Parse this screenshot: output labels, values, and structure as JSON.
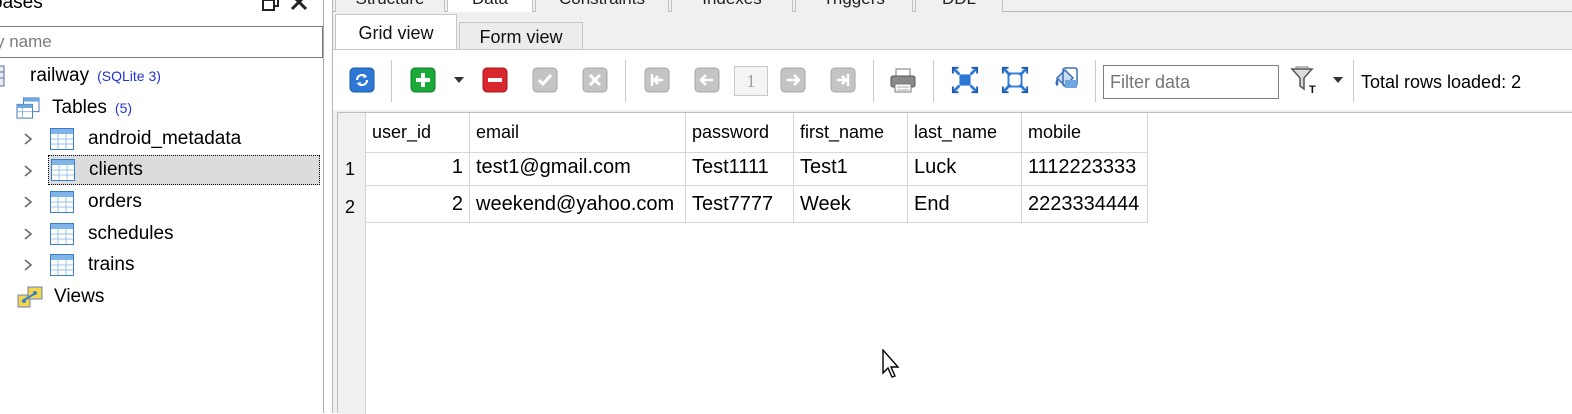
{
  "left_panel": {
    "title": "bases",
    "filter_placeholder": "y name",
    "tree": {
      "database": {
        "label": "railway",
        "note": "(SQLite 3)"
      },
      "tables": {
        "label": "Tables",
        "count": "(5)"
      },
      "table_items": [
        "android_metadata",
        "clients",
        "orders",
        "schedules",
        "trains"
      ],
      "views": {
        "label": "Views"
      }
    }
  },
  "tabs": {
    "top": [
      "Structure",
      "Data",
      "Constraints",
      "Indexes",
      "Triggers",
      "DDL"
    ],
    "sub": [
      "Grid view",
      "Form view"
    ]
  },
  "toolbar": {
    "page_number": "1",
    "filter_placeholder": "Filter data",
    "total_rows": "Total rows loaded: 2"
  },
  "grid": {
    "columns": [
      "user_id",
      "email",
      "password",
      "first_name",
      "last_name",
      "mobile"
    ],
    "rows": [
      {
        "num": "1",
        "user_id": "1",
        "email": "test1@gmail.com",
        "password": "Test1111",
        "first_name": "Test1",
        "last_name": "Luck",
        "mobile": "1112223333"
      },
      {
        "num": "2",
        "user_id": "2",
        "email": "weekend@yahoo.com",
        "password": "Test7777",
        "first_name": "Week",
        "last_name": "End",
        "mobile": "2223334444"
      }
    ]
  },
  "icons": {
    "refresh": "refresh-icon",
    "add": "add-row-icon",
    "delete": "delete-row-icon",
    "commit": "commit-icon",
    "rollback": "rollback-icon",
    "print": "print-icon",
    "filter": "filter-icon"
  },
  "colors": {
    "accent_green": "#1aaa3a",
    "accent_red": "#d9272e",
    "accent_blue": "#1f7fd6",
    "tree_note": "#2233cc"
  }
}
